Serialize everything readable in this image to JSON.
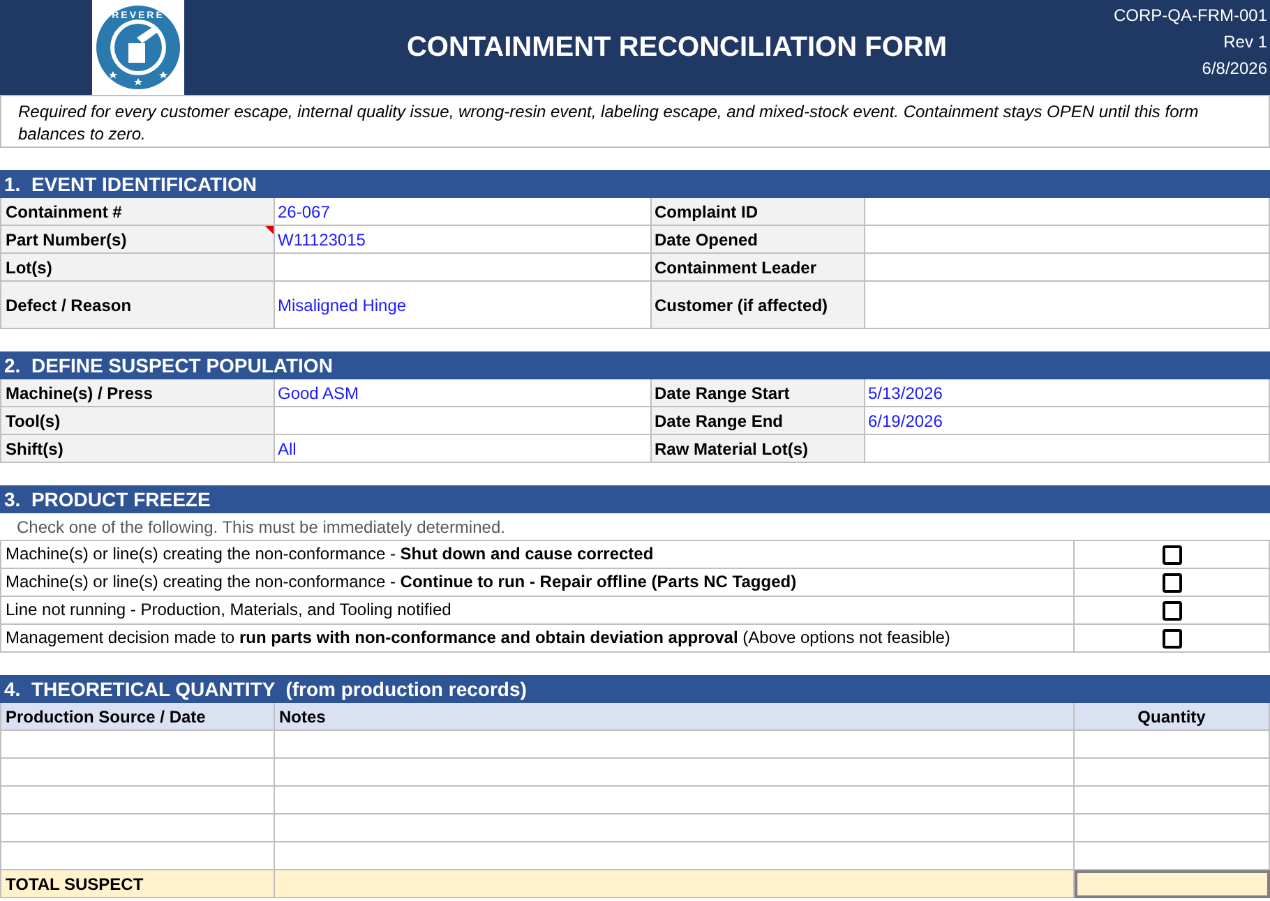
{
  "header": {
    "logo_text": "REVERE",
    "title": "CONTAINMENT RECONCILIATION FORM",
    "doc_id": "CORP-QA-FRM-001",
    "revision": "Rev 1",
    "date": "6/8/2026"
  },
  "intro": "Required for every customer escape, internal quality issue, wrong-resin event, labeling escape, and mixed-stock event. Containment stays OPEN until this form balances to zero.",
  "sections": [
    {
      "kind": "fields",
      "heading": "1.  EVENT IDENTIFICATION",
      "rows": [
        {
          "tall": false,
          "left": {
            "label": "Containment #",
            "value": "26-067",
            "has_note": false
          },
          "right": {
            "label": "Complaint ID"
          }
        },
        {
          "tall": false,
          "left": {
            "label": "Part Number(s)",
            "value": "W11123015",
            "has_note": true
          },
          "right": {
            "label": "Date Opened"
          }
        },
        {
          "tall": false,
          "left": {
            "label": "Lot(s)",
            "has_note": false
          },
          "right": {
            "label": "Containment Leader"
          }
        },
        {
          "tall": true,
          "left": {
            "label": "Defect / Reason",
            "value": "Misaligned Hinge",
            "has_note": false
          },
          "right": {
            "label": "Customer (if affected)"
          }
        }
      ]
    },
    {
      "kind": "fields",
      "heading": "2.  DEFINE SUSPECT POPULATION",
      "rows": [
        {
          "tall": false,
          "left": {
            "label": "Machine(s) / Press",
            "value": "Good ASM",
            "has_note": false
          },
          "right": {
            "label": "Date Range Start",
            "value": "5/13/2026"
          }
        },
        {
          "tall": false,
          "left": {
            "label": "Tool(s)",
            "has_note": false
          },
          "right": {
            "label": "Date Range End",
            "value": "6/19/2026"
          }
        },
        {
          "tall": false,
          "left": {
            "label": "Shift(s)",
            "value": "All",
            "has_note": false
          },
          "right": {
            "label": "Raw Material Lot(s)"
          }
        }
      ]
    },
    {
      "kind": "checklist",
      "heading": "3.  PRODUCT FREEZE",
      "instruction": "Check one of the following. This must be immediately determined.",
      "options": [
        {
          "text": "Machine(s) or line(s) creating the non-conformance - **Shut down and cause corrected**",
          "checked": false
        },
        {
          "text": "Machine(s) or line(s) creating the non-conformance - **Continue to run - Repair offline (Parts NC Tagged)**",
          "checked": false
        },
        {
          "text": "Line not running - Production, Materials, and Tooling notified",
          "checked": false
        },
        {
          "text": "Management decision made to **run parts with non-conformance and obtain deviation approval** (Above options not feasible)",
          "checked": false
        }
      ]
    },
    {
      "kind": "table",
      "heading": "4.  THEORETICAL QUANTITY  (from production records)",
      "columns": [
        "Production Source / Date",
        "Notes",
        "Quantity"
      ],
      "total_label": "TOTAL SUSPECT"
    }
  ]
}
